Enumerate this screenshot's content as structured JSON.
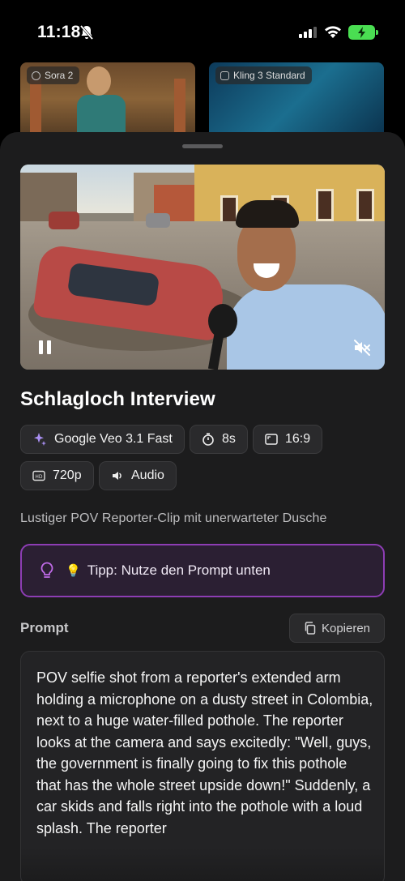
{
  "status_bar": {
    "time": "11:18"
  },
  "background_cards": [
    {
      "label": "Sora 2"
    },
    {
      "label": "Kling 3 Standard"
    }
  ],
  "video": {
    "state": "playing",
    "muted": true
  },
  "detail": {
    "title": "Schlagloch Interview",
    "chips": [
      {
        "icon": "sparkle-icon",
        "label": "Google Veo 3.1 Fast"
      },
      {
        "icon": "timer-icon",
        "label": "8s"
      },
      {
        "icon": "aspect-ratio-icon",
        "label": "16:9"
      },
      {
        "icon": "resolution-icon",
        "label": "720p"
      },
      {
        "icon": "speaker-icon",
        "label": "Audio"
      }
    ],
    "description": "Lustiger POV Reporter-Clip mit unerwarteter Dusche",
    "tip": "Tipp: Nutze den Prompt unten",
    "prompt_label": "Prompt",
    "copy_label": "Kopieren",
    "prompt_text": "POV selfie shot from a reporter's extended arm holding a microphone on a dusty street in Colombia, next to a huge water-filled pothole. The reporter looks at the camera and says excitedly: \"Well, guys, the government is finally going to fix this pothole that has the whole street upside down!\" Suddenly, a car skids and falls right into the pothole with a loud splash. The reporter"
  },
  "colors": {
    "sheet_bg": "#1c1c1d",
    "chip_bg": "#2a2a2c",
    "tip_border": "#8d3db4",
    "tip_bg": "#2b1f33",
    "battery": "#4ade52"
  }
}
